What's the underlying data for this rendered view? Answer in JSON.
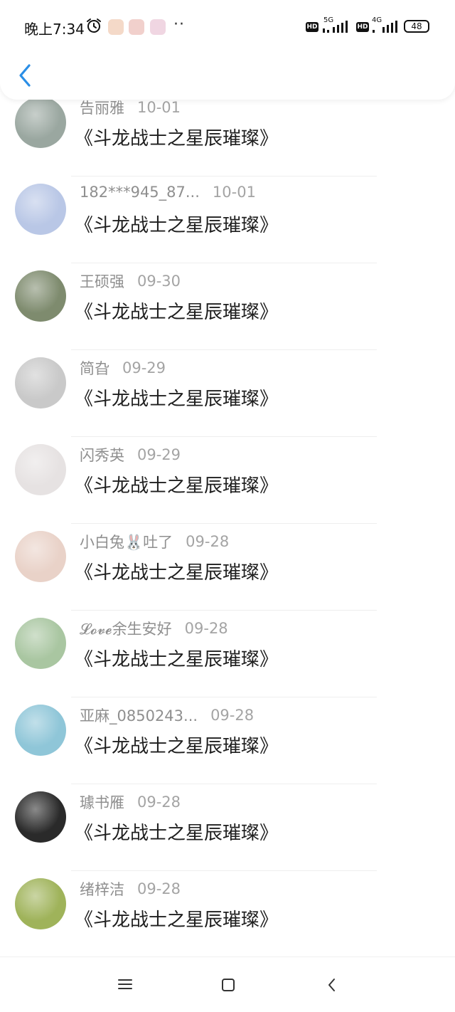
{
  "status_bar": {
    "time": "晚上7:34",
    "hd1": "HD",
    "net1": "5G",
    "hd2": "HD",
    "net2": "4G",
    "battery": "48",
    "more": "··"
  },
  "header": {
    "back_icon": "chevron-left-icon",
    "accent_color": "#2a8ee6"
  },
  "messages": [
    {
      "name": "告丽雅",
      "date": "10-01",
      "title": "《斗龙战士之星辰璀璨》",
      "avatar_color": "#9aa7a0"
    },
    {
      "name": "182***945_87...",
      "date": "10-01",
      "title": "《斗龙战士之星辰璀璨》",
      "avatar_color": "#b9c7e6"
    },
    {
      "name": "王硕强",
      "date": "09-30",
      "title": "《斗龙战士之星辰璀璨》",
      "avatar_color": "#7e8b6e"
    },
    {
      "name": "简旮",
      "date": "09-29",
      "title": "《斗龙战士之星辰璀璨》",
      "avatar_color": "#c9c9c9"
    },
    {
      "name": "闪秀英",
      "date": "09-29",
      "title": "《斗龙战士之星辰璀璨》",
      "avatar_color": "#e6e2e2"
    },
    {
      "name": "小白兔🐰吐了",
      "date": "09-28",
      "title": "《斗龙战士之星辰璀璨》",
      "avatar_color": "#e9d2c8"
    },
    {
      "name": "𝓛𝓸𝓿𝓮余生安好",
      "date": "09-28",
      "title": "《斗龙战士之星辰璀璨》",
      "avatar_color": "#a9c6a1"
    },
    {
      "name": "亚麻_0850243...",
      "date": "09-28",
      "title": "《斗龙战士之星辰璀璨》",
      "avatar_color": "#8fc6d8"
    },
    {
      "name": "璩书雁",
      "date": "09-28",
      "title": "《斗龙战士之星辰璀璨》",
      "avatar_color": "#2a2a2a"
    },
    {
      "name": "绪梓洁",
      "date": "09-28",
      "title": "《斗龙战士之星辰璀璨》",
      "avatar_color": "#9fb35a"
    }
  ],
  "nav_bar": {
    "menu_icon": "menu-icon",
    "home_icon": "home-square-icon",
    "back_icon": "back-triangle-icon"
  }
}
